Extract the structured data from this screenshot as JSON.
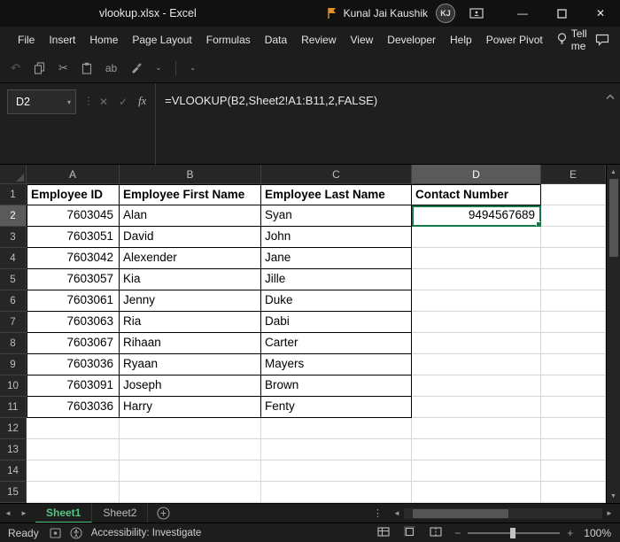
{
  "title_bar": {
    "title": "vlookup.xlsx  -  Excel",
    "user_name": "Kunal Jai Kaushik",
    "user_initials": "KJ"
  },
  "menu_bar": {
    "items": [
      "File",
      "Insert",
      "Home",
      "Page Layout",
      "Formulas",
      "Data",
      "Review",
      "View",
      "Developer",
      "Help",
      "Power Pivot"
    ],
    "tell_me_label": "Tell me"
  },
  "toolbar": {
    "find_label": "ab"
  },
  "formula_bar": {
    "cell_reference": "D2",
    "cancel_label": "✕",
    "enter_label": "✓",
    "fx_label": "fx",
    "formula": "=VLOOKUP(B2,Sheet2!A1:B11,2,FALSE)"
  },
  "grid": {
    "column_headers": [
      "A",
      "B",
      "C",
      "D",
      "E"
    ],
    "row_headers": [
      "1",
      "2",
      "3",
      "4",
      "5",
      "6",
      "7",
      "8",
      "9",
      "10",
      "11",
      "12",
      "13",
      "14",
      "15"
    ],
    "selected_column": "D",
    "selected_row": "2",
    "selected_cell": "D2",
    "rows": [
      [
        "Employee ID",
        "Employee First Name",
        "Employee Last Name",
        "Contact Number"
      ],
      [
        "7603045",
        "Alan",
        "Syan",
        "9494567689"
      ],
      [
        "7603051",
        "David",
        "John",
        ""
      ],
      [
        "7603042",
        "Alexender",
        "Jane",
        ""
      ],
      [
        "7603057",
        "Kia",
        "Jille",
        ""
      ],
      [
        "7603061",
        "Jenny",
        "Duke",
        ""
      ],
      [
        "7603063",
        "Ria",
        "Dabi",
        ""
      ],
      [
        "7603067",
        "Rihaan",
        "Carter",
        ""
      ],
      [
        "7603036",
        "Ryaan",
        "Mayers",
        ""
      ],
      [
        "7603091",
        "Joseph",
        "Brown",
        ""
      ],
      [
        "7603036",
        "Harry",
        "Fenty",
        ""
      ]
    ]
  },
  "sheet_tabs": {
    "tabs": [
      {
        "label": "Sheet1",
        "active": true
      },
      {
        "label": "Sheet2",
        "active": false
      }
    ]
  },
  "status_bar": {
    "mode": "Ready",
    "accessibility": "Accessibility: Investigate",
    "zoom": "100%"
  },
  "colors": {
    "selection_green": "#17754b",
    "active_tab_green": "#52c57f",
    "flag_orange": "#e0912f"
  }
}
